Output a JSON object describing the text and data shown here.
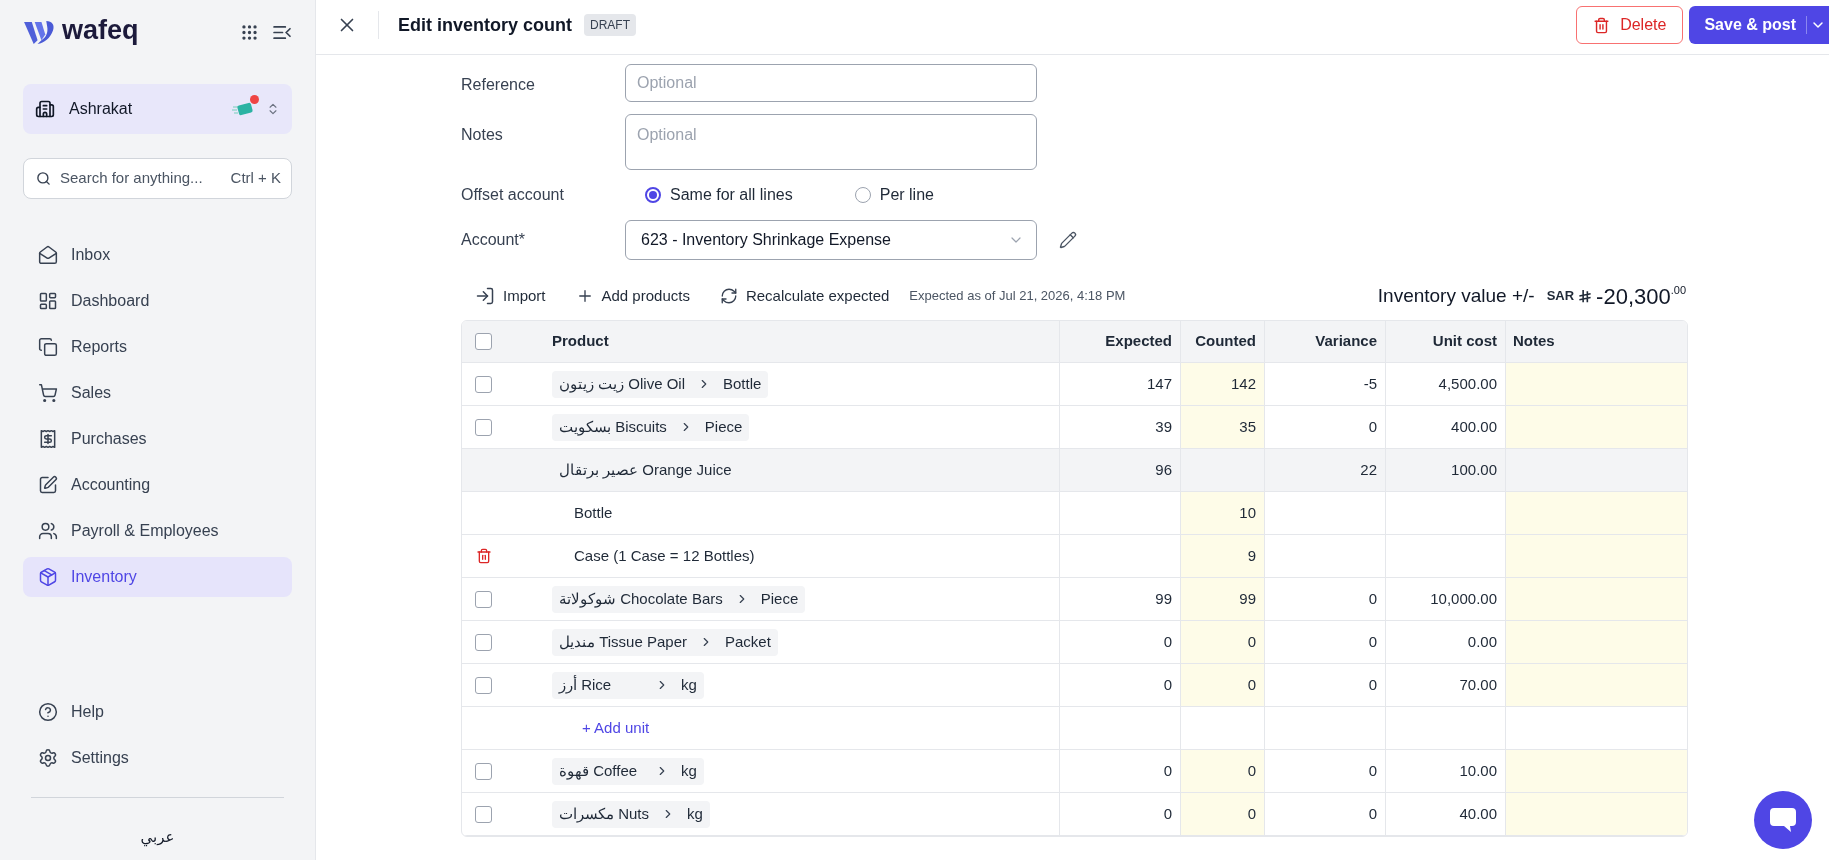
{
  "sidebar": {
    "brand": "wafeq",
    "company": {
      "name": "Ashrakat",
      "has_notification": true
    },
    "search": {
      "placeholder": "Search for anything...",
      "shortcut": "Ctrl + K"
    },
    "nav": [
      {
        "label": "Inbox",
        "selected": false
      },
      {
        "label": "Dashboard",
        "selected": false
      },
      {
        "label": "Reports",
        "selected": false
      },
      {
        "label": "Sales",
        "selected": false
      },
      {
        "label": "Purchases",
        "selected": false
      },
      {
        "label": "Accounting",
        "selected": false
      },
      {
        "label": "Payroll & Employees",
        "selected": false
      },
      {
        "label": "Inventory",
        "selected": true
      }
    ],
    "footer_nav": [
      {
        "label": "Help"
      },
      {
        "label": "Settings"
      }
    ],
    "language": "عربي"
  },
  "header": {
    "title": "Edit inventory count",
    "status": "DRAFT",
    "buttons": [
      {
        "kind": "danger",
        "label": "Delete"
      },
      {
        "kind": "primary_split",
        "label": "Save & post"
      }
    ]
  },
  "form": {
    "reference": {
      "label": "Reference",
      "placeholder": "Optional"
    },
    "notes": {
      "label": "Notes",
      "placeholder": "Optional"
    },
    "offset_account": {
      "label": "Offset account",
      "options": [
        {
          "label": "Same for all lines",
          "selected": true
        },
        {
          "label": "Per line",
          "selected": false
        }
      ]
    },
    "account": {
      "label": "Account*",
      "value": "623 - Inventory Shrinkage Expense"
    }
  },
  "toolbar": {
    "actions": [
      {
        "kind": "import",
        "label": "Import"
      },
      {
        "kind": "add",
        "label": "Add products"
      },
      {
        "kind": "recalculate",
        "label": "Recalculate expected"
      }
    ],
    "expected_as_of": "Expected as of Jul 21, 2026, 4:18 PM",
    "inventory_value": {
      "label": "Inventory value +/-",
      "currency": "SAR",
      "amount": "-20,300$^{.00}$"
    }
  },
  "table": {
    "select_all": false,
    "columns": [
      "Product",
      "Expected",
      "Counted",
      "Variance",
      "Unit cost",
      "Notes"
    ],
    "rows": [
      {
        "kind": "product",
        "checked": false,
        "name": "زيت زيتون Olive Oil",
        "unit": "Bottle",
        "expected": "147",
        "counted": "142",
        "variance": "-5",
        "unit_cost": "4,500.00"
      },
      {
        "kind": "product",
        "checked": false,
        "name": "بسكويت Biscuits",
        "unit": "Piece",
        "expected": "39",
        "counted": "35",
        "variance": "0",
        "unit_cost": "400.00"
      },
      {
        "kind": "group",
        "name": "عصير برتقال Orange Juice",
        "expected": "96",
        "variance": "22",
        "unit_cost": "100.00",
        "children": [
          {
            "name": "Bottle",
            "counted": "10",
            "deletable": false
          },
          {
            "name": "Case (1 Case = 12 Bottles)",
            "counted": "9",
            "deletable": true
          }
        ]
      },
      {
        "kind": "product",
        "checked": false,
        "name": "شوكولاتة Chocolate Bars",
        "unit": "Piece",
        "expected": "99",
        "counted": "99",
        "variance": "0",
        "unit_cost": "10,000.00"
      },
      {
        "kind": "product",
        "checked": false,
        "name": "منديل Tissue Paper",
        "unit": "Packet",
        "expected": "0",
        "counted": "0",
        "variance": "0",
        "unit_cost": "0.00"
      },
      {
        "kind": "product",
        "checked": false,
        "name": "أرز Rice",
        "unit": "kg",
        "expected": "0",
        "counted": "0",
        "variance": "0",
        "unit_cost": "70.00"
      },
      {
        "kind": "add_unit",
        "label": "+ Add unit"
      },
      {
        "kind": "product",
        "checked": false,
        "name": "قهوة Coffee",
        "unit": "kg",
        "expected": "0",
        "counted": "0",
        "variance": "0",
        "unit_cost": "10.00"
      },
      {
        "kind": "product",
        "checked": false,
        "name": "مكسرات Nuts",
        "unit": "kg",
        "expected": "0",
        "counted": "0",
        "variance": "0",
        "unit_cost": "40.00"
      }
    ]
  }
}
